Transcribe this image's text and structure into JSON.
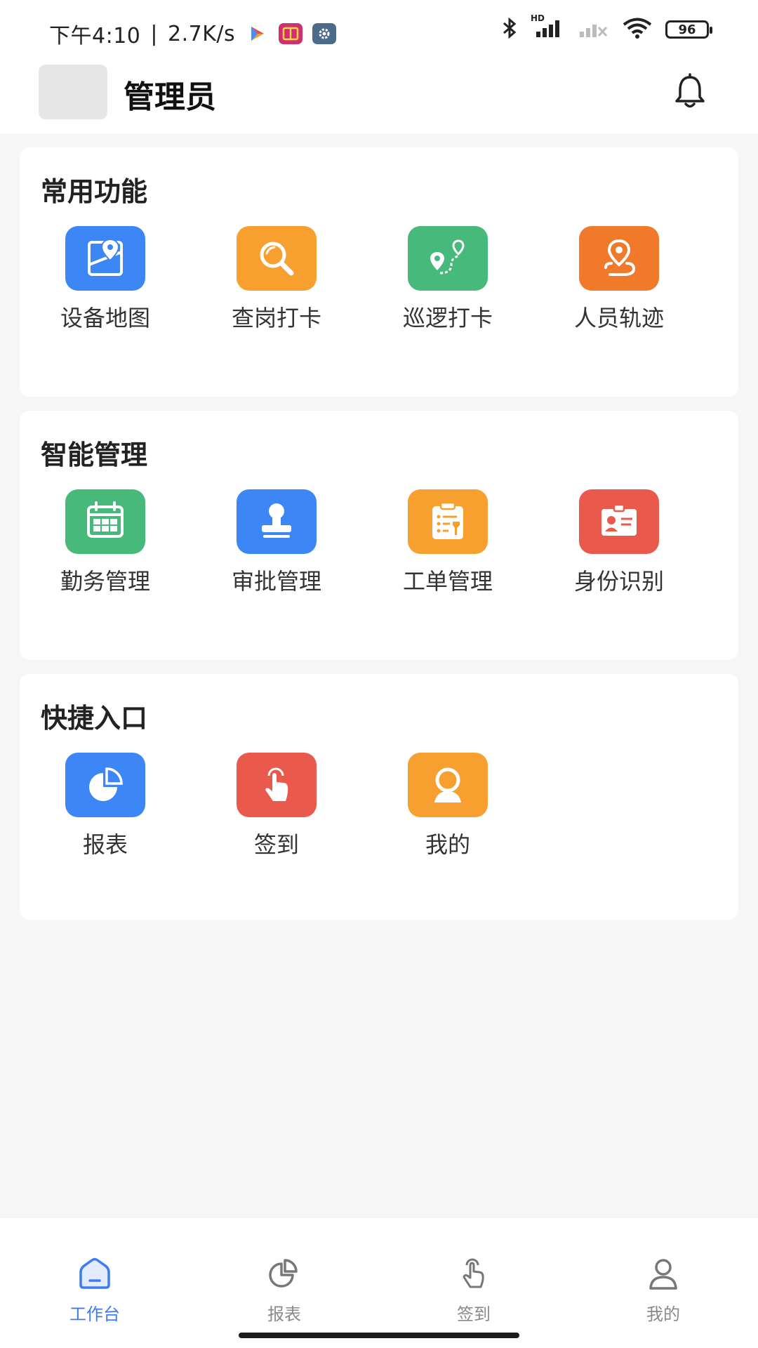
{
  "status_bar": {
    "time": "下午4:10",
    "separator": "|",
    "speed": "2.7K/s",
    "battery": "96",
    "network_badge": "HD",
    "icons": [
      "play-store-icon",
      "book-app-icon",
      "gear-app-icon",
      "bluetooth-icon",
      "signal-icon",
      "signal-disabled-icon",
      "wifi-icon",
      "battery-icon"
    ]
  },
  "header": {
    "user_name": "管理员",
    "bell_icon": "bell-icon"
  },
  "sections": [
    {
      "title": "常用功能",
      "items": [
        {
          "label": "设备地图",
          "icon": "map-icon",
          "color": "#3d86f5"
        },
        {
          "label": "查岗打卡",
          "icon": "magnifier-icon",
          "color": "#f7a030"
        },
        {
          "label": "巡逻打卡",
          "icon": "route-pin-icon",
          "color": "#47b97a"
        },
        {
          "label": "人员轨迹",
          "icon": "location-track-icon",
          "color": "#f07a2a"
        }
      ]
    },
    {
      "title": "智能管理",
      "items": [
        {
          "label": "勤务管理",
          "icon": "calendar-icon",
          "color": "#47b97a"
        },
        {
          "label": "审批管理",
          "icon": "stamp-icon",
          "color": "#3d86f5"
        },
        {
          "label": "工单管理",
          "icon": "clipboard-icon",
          "color": "#f7a030"
        },
        {
          "label": "身份识别",
          "icon": "id-card-icon",
          "color": "#ea5a4c"
        }
      ]
    },
    {
      "title": "快捷入口",
      "items": [
        {
          "label": "报表",
          "icon": "pie-chart-icon",
          "color": "#3d86f5"
        },
        {
          "label": "签到",
          "icon": "tap-hand-icon",
          "color": "#ea5a4c"
        },
        {
          "label": "我的",
          "icon": "user-face-icon",
          "color": "#f7a030"
        }
      ]
    }
  ],
  "bottom_nav": [
    {
      "label": "工作台",
      "icon": "home-icon",
      "active": true
    },
    {
      "label": "报表",
      "icon": "pie-chart-icon",
      "active": false
    },
    {
      "label": "签到",
      "icon": "tap-hand-icon",
      "active": false
    },
    {
      "label": "我的",
      "icon": "person-icon",
      "active": false
    }
  ],
  "colors": {
    "accent": "#3d7cf2",
    "inactive": "#8a8a8a",
    "background": "#f6f6f7"
  }
}
